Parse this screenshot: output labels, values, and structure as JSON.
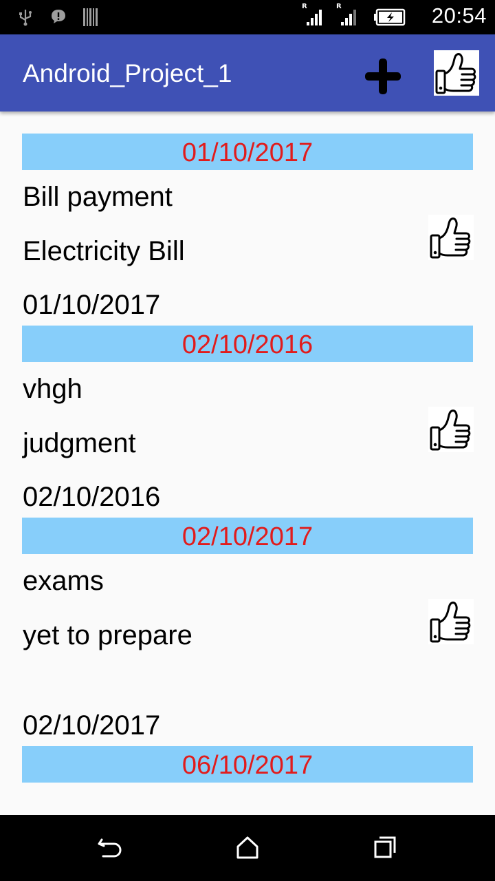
{
  "status_bar": {
    "time": "20:54",
    "icons": [
      "usb-icon",
      "chat-notification-icon",
      "barcode-icon",
      "signal-icon",
      "signal-icon",
      "battery-charging-icon"
    ]
  },
  "app_bar": {
    "title": "Android_Project_1",
    "add_icon": "plus-icon",
    "like_icon": "thumbs-up-icon"
  },
  "list": {
    "groups": [
      {
        "date_header": "01/10/2017",
        "title": "Bill payment",
        "description": "Electricity Bill",
        "date": "01/10/2017"
      },
      {
        "date_header": "02/10/2016",
        "title": "vhgh",
        "description": "judgment",
        "date": "02/10/2016"
      },
      {
        "date_header": "02/10/2017",
        "title": "exams",
        "description": "yet to prepare",
        "date": "02/10/2017"
      },
      {
        "date_header": "06/10/2017"
      }
    ]
  },
  "nav_bar": {
    "icons": [
      "back-icon",
      "home-icon",
      "recents-icon"
    ]
  },
  "colors": {
    "app_bar": "#3f51b5",
    "date_header_bg": "#87cefa",
    "date_header_text": "#e11c1c"
  }
}
